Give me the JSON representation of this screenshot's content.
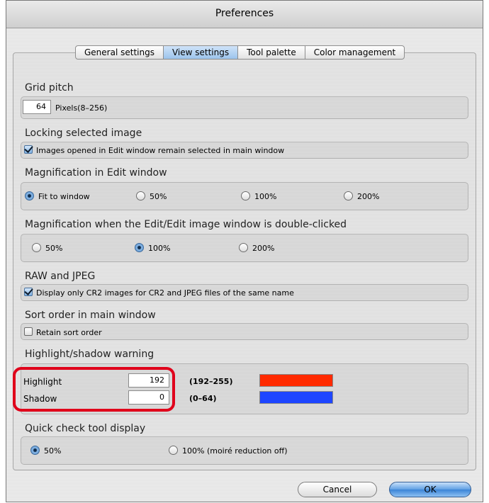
{
  "window": {
    "title": "Preferences"
  },
  "tabs": [
    {
      "label": "General settings",
      "active": false
    },
    {
      "label": "View settings",
      "active": true
    },
    {
      "label": "Tool palette",
      "active": false
    },
    {
      "label": "Color management",
      "active": false
    }
  ],
  "grid_pitch": {
    "title": "Grid pitch",
    "value": "64",
    "range_label": "Pixels(8–256)"
  },
  "locking": {
    "title": "Locking selected image",
    "checkbox_label": "Images opened in Edit window remain selected in main window",
    "checked": true
  },
  "magnification_edit": {
    "title": "Magnification in Edit window",
    "options": [
      "Fit to window",
      "50%",
      "100%",
      "200%"
    ],
    "selected": "Fit to window"
  },
  "magnification_double": {
    "title": "Magnification when the Edit/Edit image window is double-clicked",
    "options": [
      "50%",
      "100%",
      "200%"
    ],
    "selected": "100%"
  },
  "raw_jpeg": {
    "title": "RAW and JPEG",
    "checkbox_label": "Display only CR2 images for CR2 and JPEG files of the same name",
    "checked": true
  },
  "sort_order": {
    "title": "Sort order in main window",
    "checkbox_label": "Retain sort order",
    "checked": false
  },
  "warning": {
    "title": "Highlight/shadow warning",
    "highlight_label": "Highlight",
    "highlight_value": "192",
    "highlight_range": "(192–255)",
    "highlight_color": "#ff2a00",
    "shadow_label": "Shadow",
    "shadow_value": "0",
    "shadow_range": "(0–64)",
    "shadow_color": "#1e46ff"
  },
  "quick_check": {
    "title": "Quick check tool display",
    "options": [
      "50%",
      "100% (moiré reduction off)"
    ],
    "selected": "50%"
  },
  "buttons": {
    "cancel": "Cancel",
    "ok": "OK"
  },
  "annotation_color": "#e0001b"
}
